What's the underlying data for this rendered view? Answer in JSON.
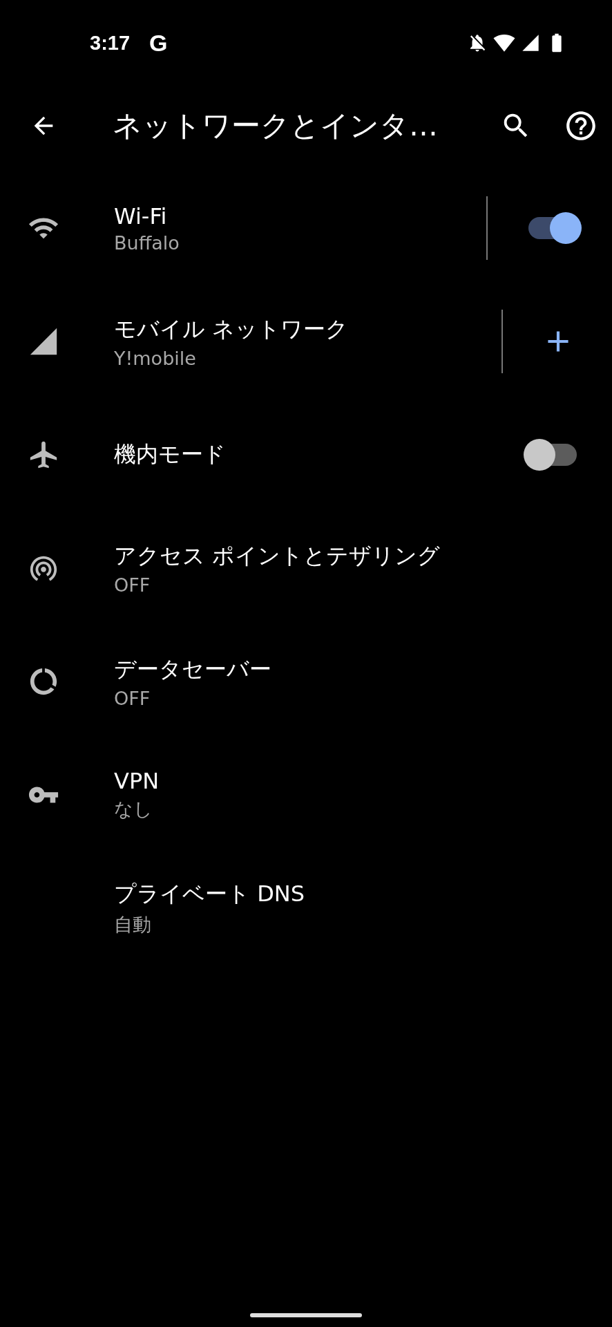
{
  "status_bar": {
    "time": "3:17",
    "app_glyph": "G"
  },
  "app_bar": {
    "title": "ネットワークとインタ…"
  },
  "items": [
    {
      "kind": "toggle",
      "title": "Wi-Fi",
      "subtitle": "Buffalo",
      "divider": true,
      "on": true
    },
    {
      "kind": "add",
      "title": "モバイル ネットワーク",
      "subtitle": "Y!mobile",
      "divider": true
    },
    {
      "kind": "toggle",
      "title": "機内モード",
      "divider": false,
      "on": false
    },
    {
      "kind": "plain",
      "title": "アクセス ポイントとテザリング",
      "subtitle": "OFF",
      "divider": false
    },
    {
      "kind": "plain",
      "title": "データセーバー",
      "subtitle": "OFF",
      "divider": false
    },
    {
      "kind": "plain",
      "title": "VPN",
      "subtitle": "なし",
      "divider": false
    },
    {
      "kind": "plain",
      "title": "プライベート DNS",
      "subtitle": "自動",
      "divider": false
    }
  ]
}
